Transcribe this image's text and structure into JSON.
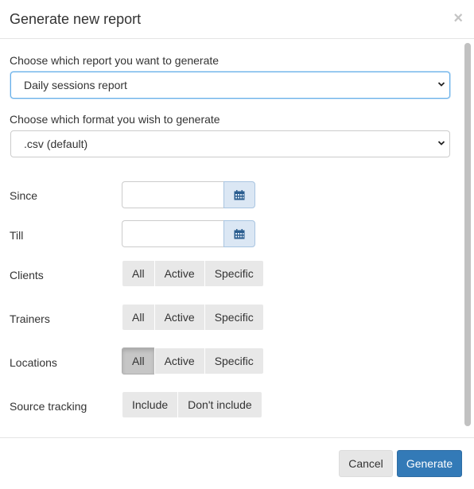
{
  "dialog": {
    "title": "Generate new report",
    "close_symbol": "×"
  },
  "report": {
    "label": "Choose which report you want to generate",
    "selected": "Daily sessions report"
  },
  "format": {
    "label": "Choose which format you wish to generate",
    "selected": ".csv (default)"
  },
  "since": {
    "label": "Since",
    "value": "",
    "icon": "calendar-icon"
  },
  "till": {
    "label": "Till",
    "value": "",
    "icon": "calendar-icon"
  },
  "clients": {
    "label": "Clients",
    "options": [
      "All",
      "Active",
      "Specific"
    ],
    "active_index": -1
  },
  "trainers": {
    "label": "Trainers",
    "options": [
      "All",
      "Active",
      "Specific"
    ],
    "active_index": -1
  },
  "locations": {
    "label": "Locations",
    "options": [
      "All",
      "Active",
      "Specific"
    ],
    "active_index": 0
  },
  "source_tracking": {
    "label": "Source tracking",
    "options": [
      "Include",
      "Don't include"
    ],
    "active_index": -1
  },
  "footer": {
    "cancel_label": "Cancel",
    "generate_label": "Generate"
  },
  "colors": {
    "primary": "#337ab7",
    "focus_border": "#66afe9",
    "date_button_bg": "#dbe7f4",
    "segment_bg": "#e8e8e8",
    "segment_active_bg": "#c6c6c6"
  }
}
